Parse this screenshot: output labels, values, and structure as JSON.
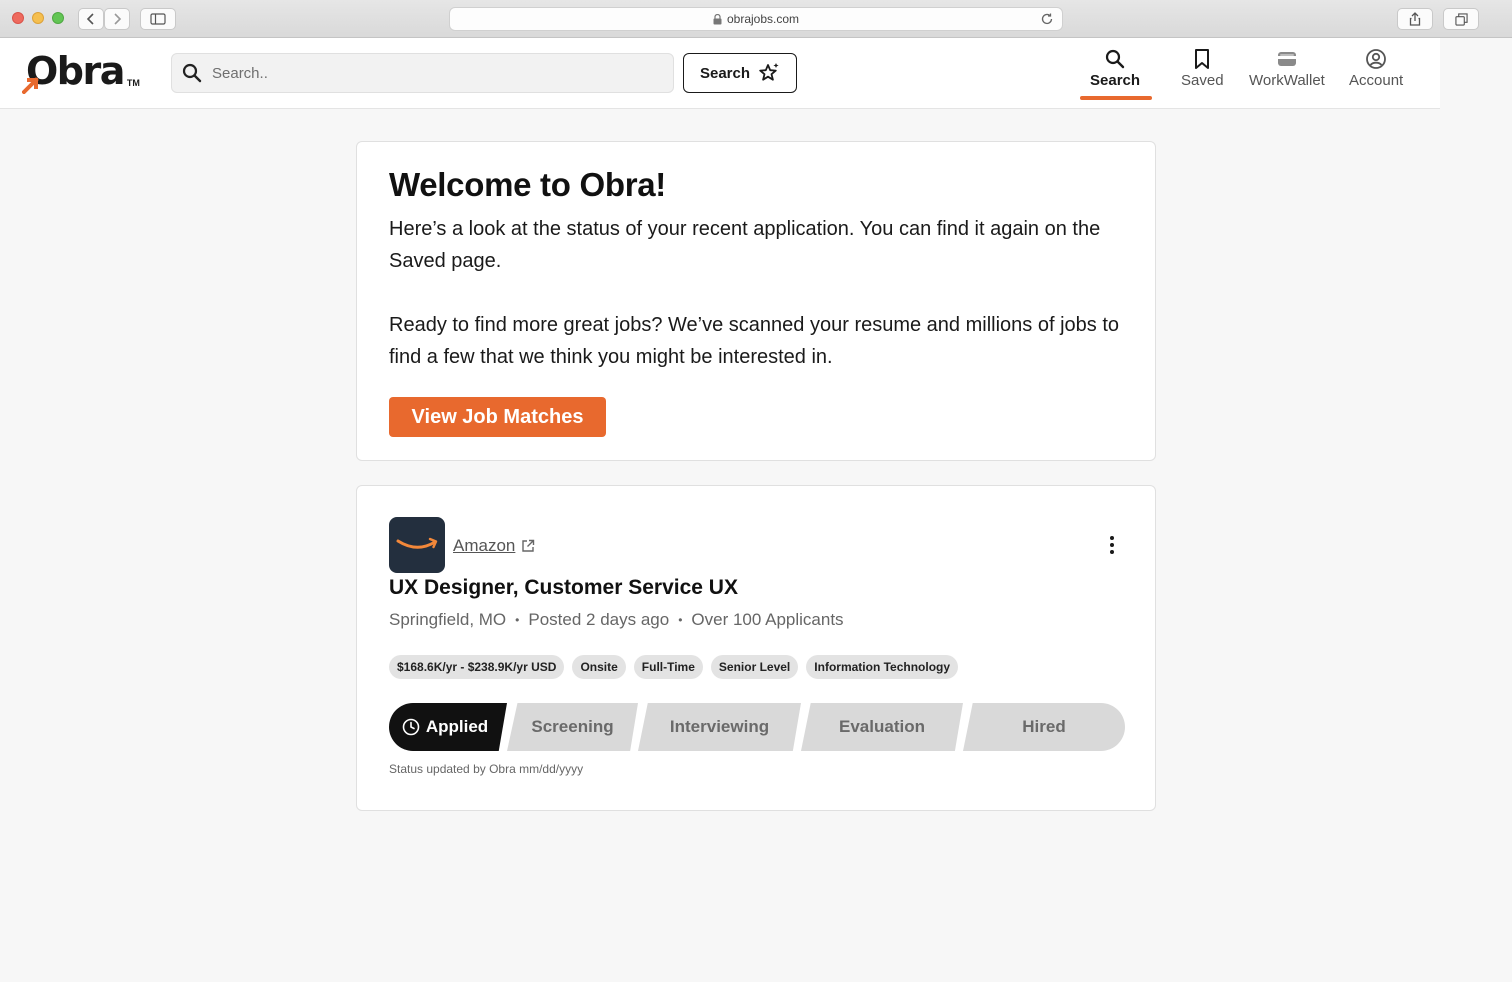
{
  "browser": {
    "url": "obrajobs.com"
  },
  "header": {
    "logo_text": "Obra",
    "logo_tm": "TM",
    "search_placeholder": "Search..",
    "search_button_label": "Search",
    "nav": [
      {
        "label": "Search",
        "icon": "search-icon",
        "active": true
      },
      {
        "label": "Saved",
        "icon": "bookmark-icon",
        "active": false
      },
      {
        "label": "WorkWallet",
        "icon": "wallet-icon",
        "active": false
      },
      {
        "label": "Account",
        "icon": "account-icon",
        "active": false
      }
    ],
    "accent_color": "#e8692e"
  },
  "welcome": {
    "title": "Welcome to Obra!",
    "paragraph1": "Here’s a look at the status of your recent application. You can find it again on the Saved page.",
    "paragraph2": "Ready to find more great jobs? We’ve scanned your resume and millions of jobs to find a few that we think you might be interested in.",
    "cta_label": "View Job Matches"
  },
  "job": {
    "company": "Amazon",
    "title": "UX Designer, Customer Service UX",
    "location": "Springfield, MO",
    "posted": "Posted 2 days ago",
    "applicants": "Over 100 Applicants",
    "tags": [
      "$168.6K/yr - $238.9K/yr USD",
      "Onsite",
      "Full-Time",
      "Senior Level",
      "Information Technology"
    ],
    "stages": [
      {
        "label": "Applied",
        "active": true
      },
      {
        "label": "Screening",
        "active": false
      },
      {
        "label": "Interviewing",
        "active": false
      },
      {
        "label": "Evaluation",
        "active": false
      },
      {
        "label": "Hired",
        "active": false
      }
    ],
    "status_note": "Status updated by Obra mm/dd/yyyy"
  }
}
